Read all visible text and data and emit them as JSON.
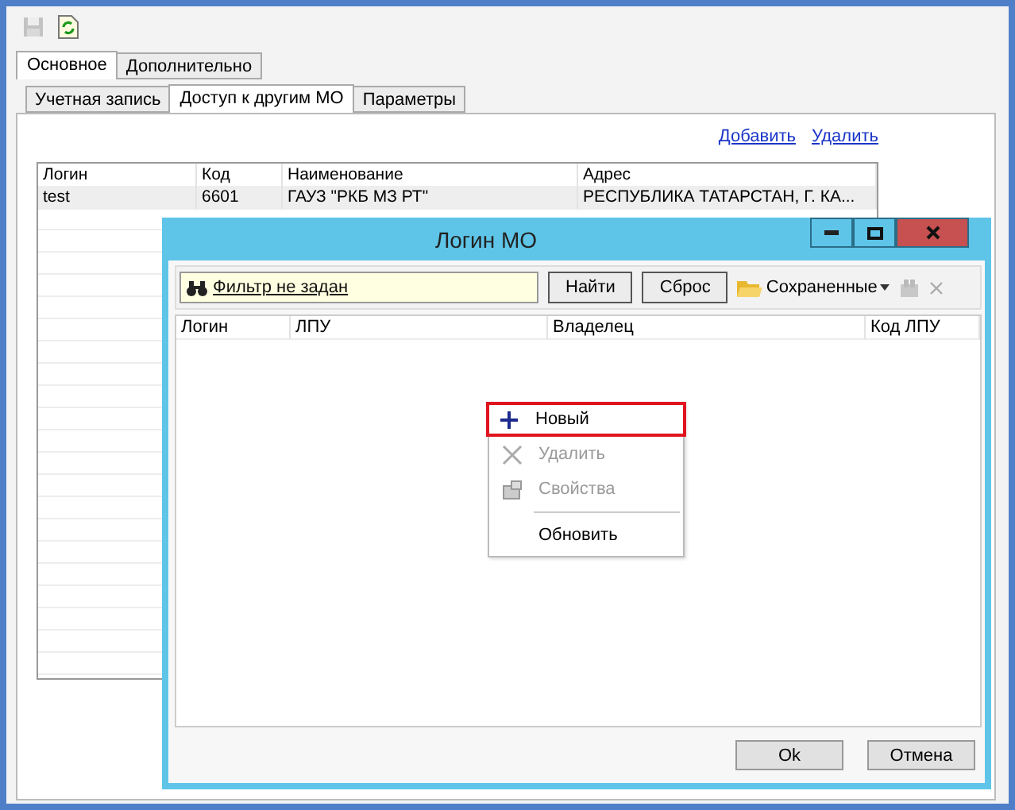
{
  "toolbar": {
    "save_disabled": true
  },
  "tabs": [
    {
      "label": "Основное",
      "selected": true
    },
    {
      "label": "Дополнительно",
      "selected": false
    }
  ],
  "subtabs": [
    {
      "label": "Учетная запись",
      "selected": false
    },
    {
      "label": "Доступ к другим МО",
      "selected": true
    },
    {
      "label": "Параметры",
      "selected": false
    }
  ],
  "links": [
    "Добавить",
    "Удалить"
  ],
  "table": {
    "columns": [
      "Логин",
      "Код",
      "Наименование",
      "Адрес"
    ],
    "rows": [
      [
        "test",
        "6601",
        "ГАУЗ \"РКБ МЗ РТ\"",
        "РЕСПУБЛИКА ТАТАРСТАН, Г. КА..."
      ]
    ]
  },
  "dialog": {
    "title": "Логин МО",
    "filter": "Фильтр не задан",
    "buttons": [
      "Найти",
      "Сброс"
    ],
    "saved": "Сохраненные",
    "columns": [
      "Логин",
      "ЛПУ",
      "Владелец",
      "Код ЛПУ"
    ],
    "context_menu": [
      {
        "kind": "item",
        "label": "Новый",
        "disabled": false,
        "selected": true
      },
      {
        "kind": "item",
        "label": "Удалить",
        "disabled": true,
        "selected": false
      },
      {
        "kind": "item",
        "label": "Свойства",
        "disabled": true,
        "selected": false
      },
      {
        "kind": "separator"
      },
      {
        "kind": "item",
        "label": "Обновить",
        "disabled": false,
        "selected": false
      }
    ],
    "footer": [
      "Ok",
      "Отмена"
    ]
  }
}
